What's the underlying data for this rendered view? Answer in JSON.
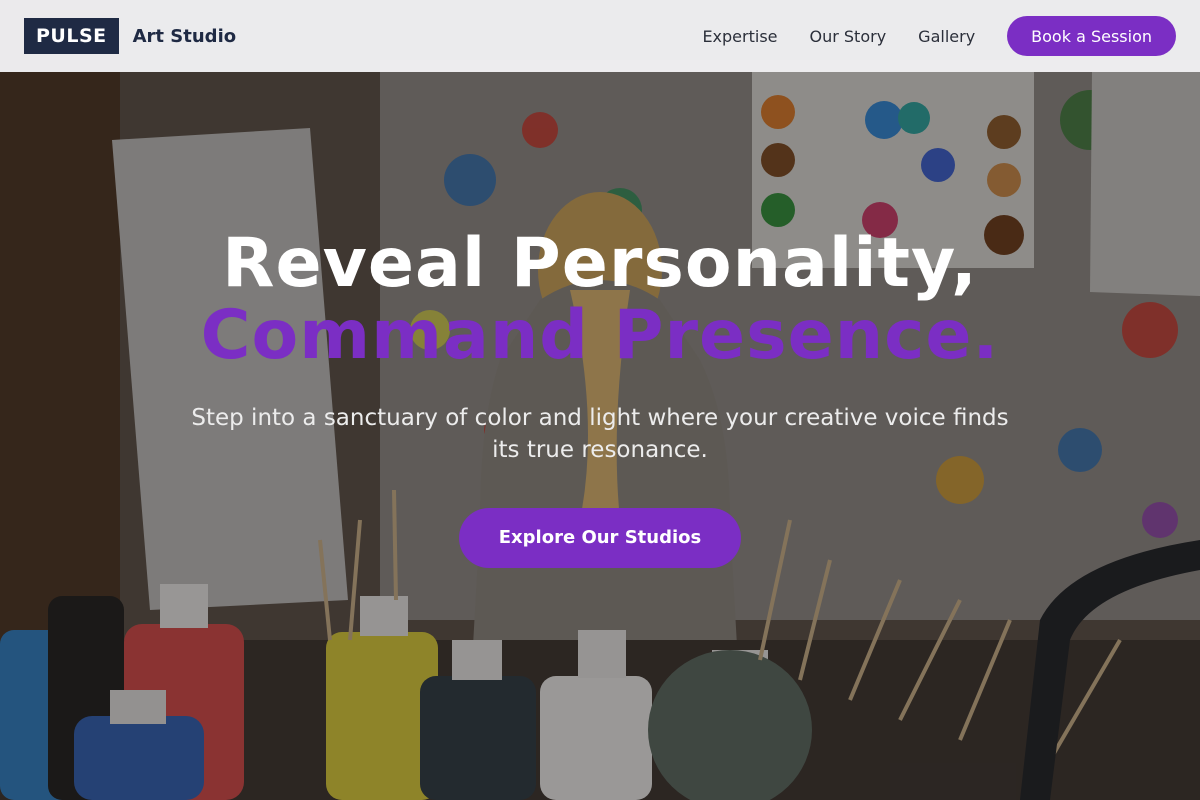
{
  "brand": {
    "logo": "PULSE",
    "name": "Art Studio"
  },
  "nav": {
    "links": [
      "Expertise",
      "Our Story",
      "Gallery"
    ],
    "cta": "Book a Session"
  },
  "hero": {
    "title_line1": "Reveal Personality,",
    "title_line2": "Command Presence.",
    "subtitle": "Step into a sanctuary of color and light where your creative voice finds its true resonance.",
    "button": "Explore Our Studios"
  },
  "colors": {
    "accent": "#7b2ec4",
    "logo_bg": "#1f2a44",
    "header_bg": "#f3f3f5"
  }
}
